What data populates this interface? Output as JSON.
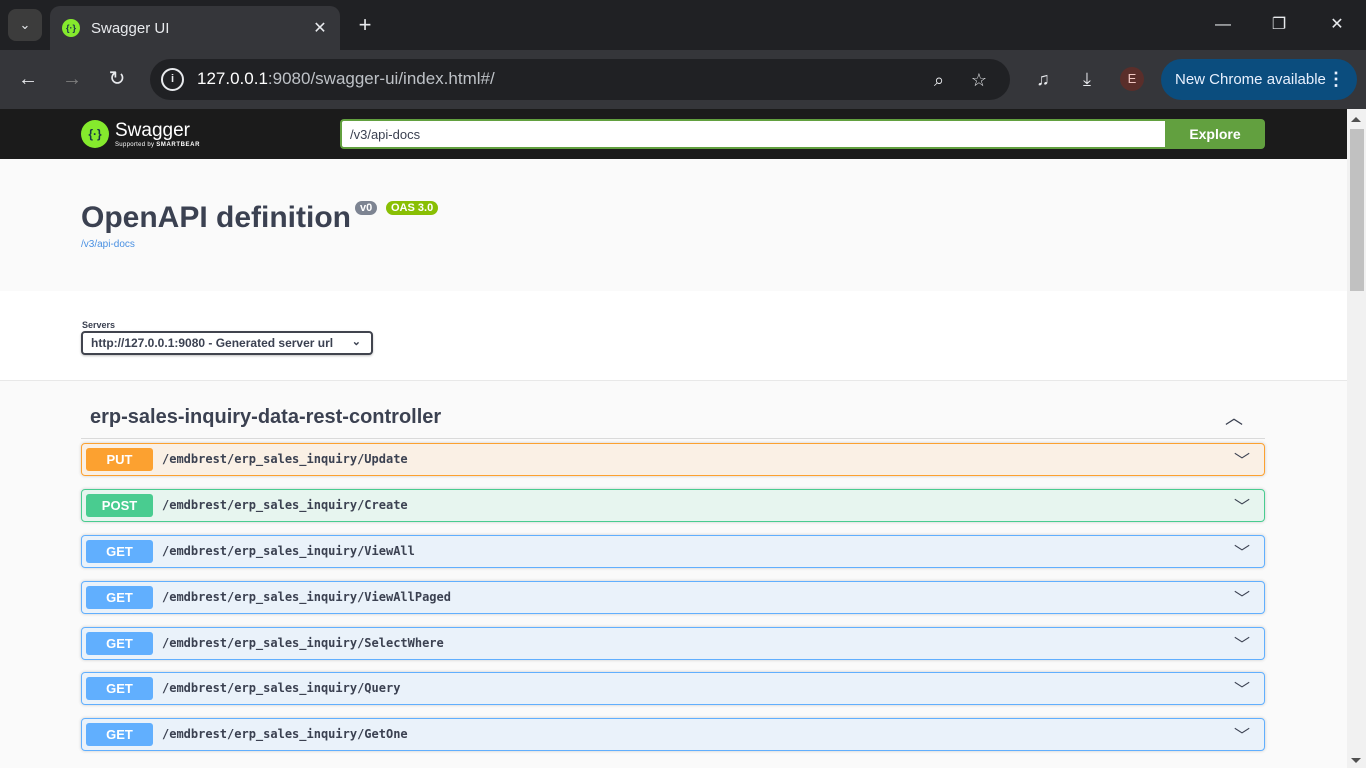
{
  "browser": {
    "tab_title": "Swagger UI",
    "url_host": "127.0.0.1",
    "url_rest": ":9080/swagger-ui/index.html#/",
    "avatar_letter": "E",
    "update_label": "New Chrome available"
  },
  "swagger": {
    "logo_name": "Swagger",
    "logo_supported": "Supported by",
    "logo_vendor": "SMARTBEAR",
    "spec_url": "/v3/api-docs",
    "explore_label": "Explore",
    "title": "OpenAPI definition",
    "version_badge": "v0",
    "oas_badge": "OAS 3.0",
    "spec_link": "/v3/api-docs",
    "servers_label": "Servers",
    "server_selected": "http://127.0.0.1:9080 - Generated server url"
  },
  "tag": {
    "name": "erp-sales-inquiry-data-rest-controller"
  },
  "operations": [
    {
      "method": "PUT",
      "path": "/emdbrest/erp_sales_inquiry/Update"
    },
    {
      "method": "POST",
      "path": "/emdbrest/erp_sales_inquiry/Create"
    },
    {
      "method": "GET",
      "path": "/emdbrest/erp_sales_inquiry/ViewAll"
    },
    {
      "method": "GET",
      "path": "/emdbrest/erp_sales_inquiry/ViewAllPaged"
    },
    {
      "method": "GET",
      "path": "/emdbrest/erp_sales_inquiry/SelectWhere"
    },
    {
      "method": "GET",
      "path": "/emdbrest/erp_sales_inquiry/Query"
    },
    {
      "method": "GET",
      "path": "/emdbrest/erp_sales_inquiry/GetOne"
    }
  ],
  "colors": {
    "put": "#fca130",
    "post": "#49cc90",
    "get": "#61affe",
    "explore": "#62a03f",
    "oas_badge": "#89bf04"
  },
  "icons": [
    "tab-search-icon",
    "swagger-favicon-icon",
    "close-icon",
    "plus-icon",
    "minimize-icon",
    "restore-icon",
    "window-close-icon",
    "back-arrow-icon",
    "forward-arrow-icon",
    "reload-icon",
    "site-info-icon",
    "zoom-icon",
    "star-icon",
    "media-icon",
    "download-icon",
    "menu-dots-icon",
    "chevron-up-icon",
    "chevron-down-icon"
  ]
}
